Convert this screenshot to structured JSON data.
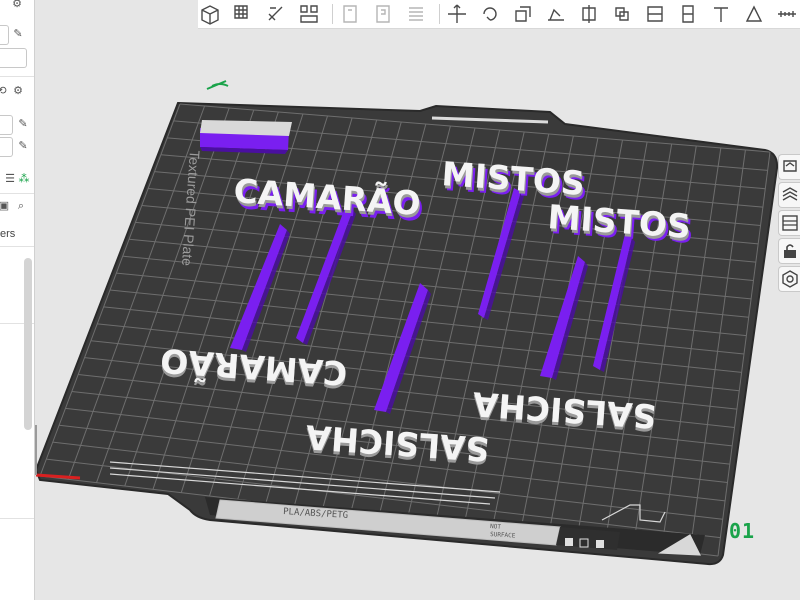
{
  "plate": {
    "name": "Textured PEI Plate",
    "filament_compat": "PLA/ABS/PETG",
    "surface_note_1": "NOT",
    "surface_note_2": "SURFACE",
    "number": "01"
  },
  "models": {
    "labels": [
      "CAMARÃO",
      "MISTOS",
      "MISTOS",
      "CAMARÃO",
      "SALSICHA",
      "SALSICHA"
    ]
  },
  "left_panel": {
    "partial_label": "ers"
  },
  "colors": {
    "filament": "#7a1ff0",
    "plate": "#3b3b3b",
    "grid": "#6a6a6a",
    "accent_green": "#1aa34a",
    "text_models": "#f4f4f4",
    "axis_x": "#d92020"
  },
  "icons": {
    "toolbar": [
      "add-cube-icon",
      "add-plate-icon",
      "orient-icon",
      "arrange-icon",
      "split-objects-icon",
      "split-parts-icon",
      "layers-icon",
      "move-icon",
      "rotate-icon",
      "scale-icon",
      "lay-on-face-icon",
      "cut-icon",
      "boolean-icon",
      "support-paint-icon",
      "seam-paint-icon",
      "text-icon",
      "color-paint-icon",
      "measure-icon"
    ]
  }
}
